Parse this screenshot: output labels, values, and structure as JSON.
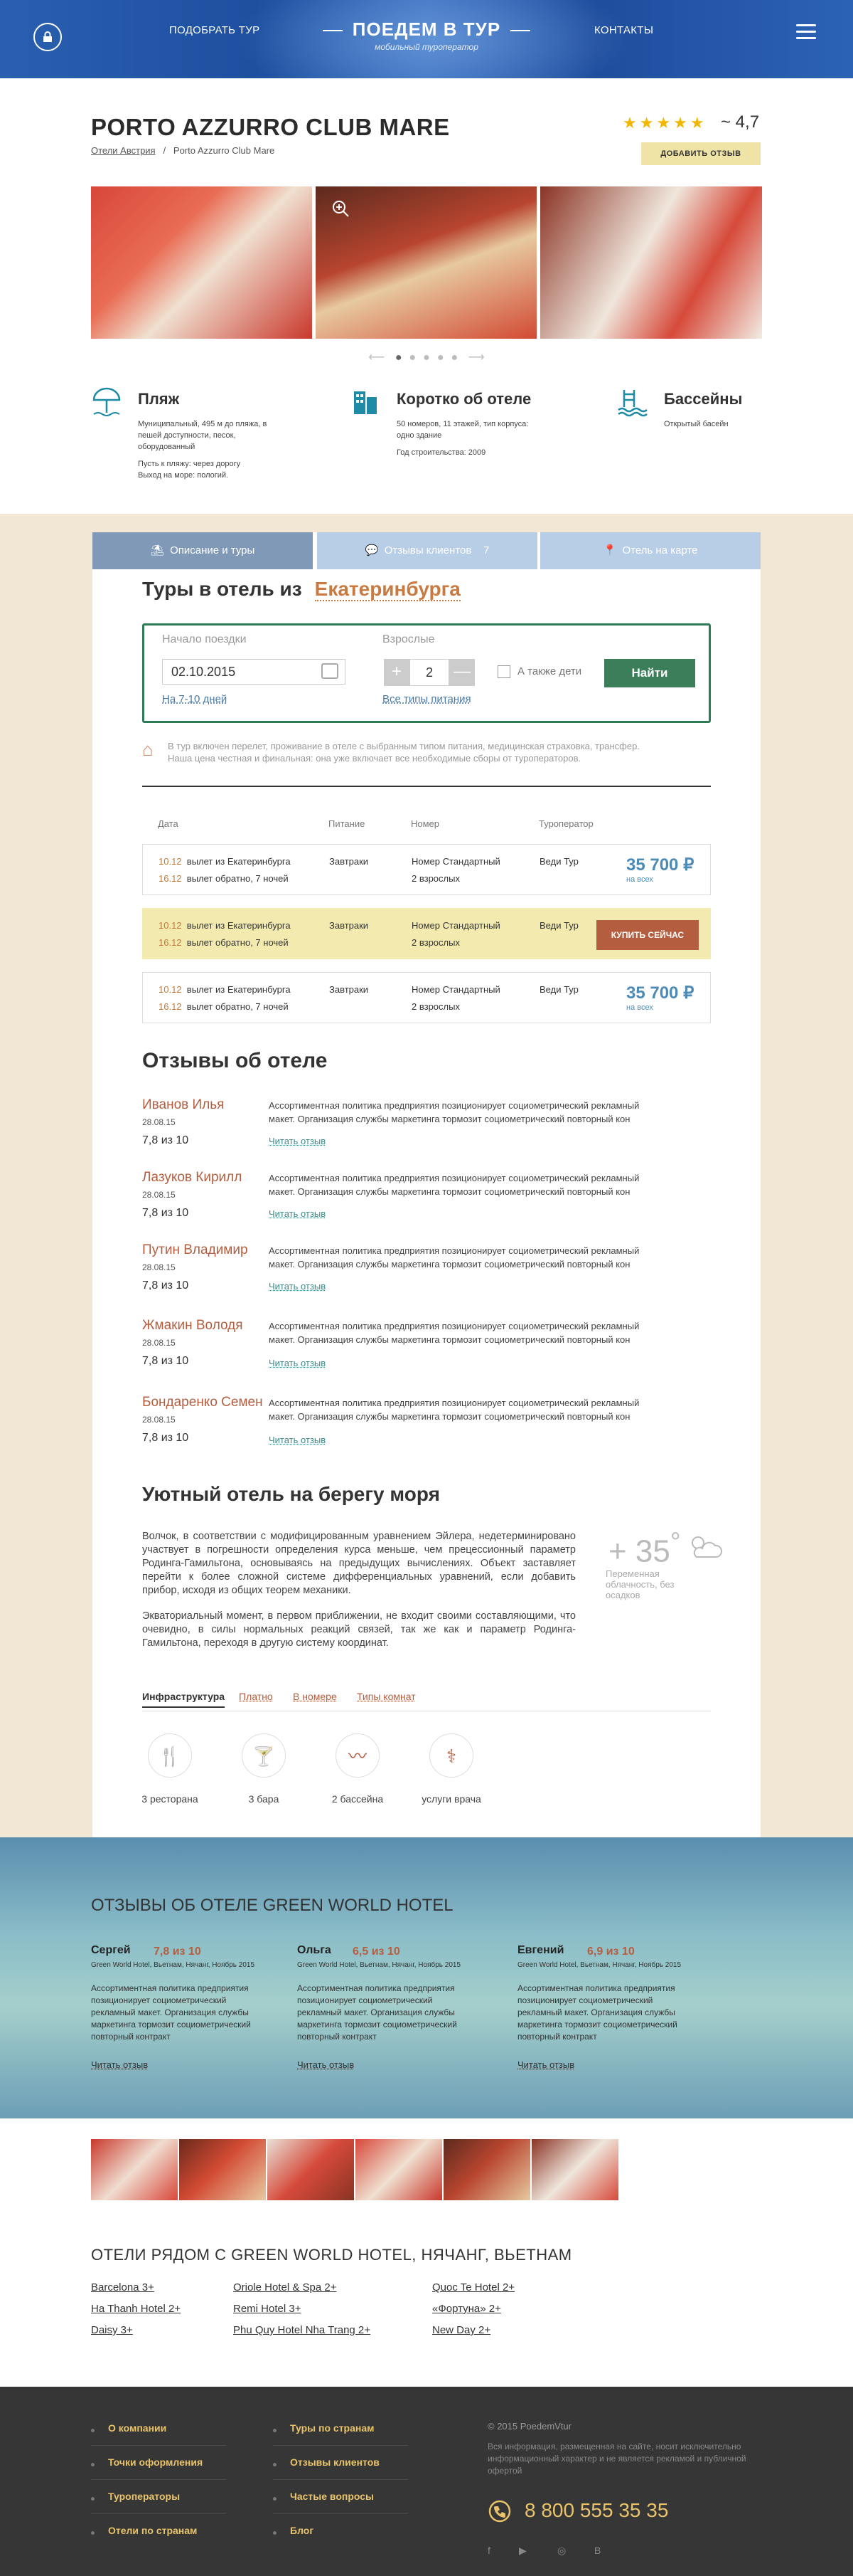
{
  "header": {
    "nav_left": "ПОДОБРАТЬ ТУР",
    "logo": "ПОЕДЕМ В ТУР",
    "logo_sub": "мобильный туроператор",
    "nav_right": "КОНТАКТЫ"
  },
  "hotel": {
    "title": "PORTO AZZURRO CLUB MARE",
    "breadcrumb_country": "Отели Австрия",
    "breadcrumb_sep": "/",
    "breadcrumb_hotel": "Porto Azzurro Club Mare",
    "stars": "★★★★★",
    "rating": "~ 4,7",
    "add_review": "ДОБАВИТЬ ОТЗЫВ"
  },
  "gallery": {
    "arrow_left": "⟵",
    "arrow_right": "⟶",
    "dots": 5
  },
  "features": [
    {
      "title": "Пляж",
      "text1": "Муниципальный, 495 м до пляжа, в пешей доступности, песок, оборудованный",
      "text2": "Пусть к пляжу: через дорогу\nВыход на море: пологий."
    },
    {
      "title": "Коротко об отеле",
      "text1": "50 номеров, 11 этажей, тип корпуса: одно здание",
      "text2": "Год строительства: 2009"
    },
    {
      "title": "Бассейны",
      "text1": "Открытый басейн",
      "text2": ""
    }
  ],
  "tabs": [
    {
      "label": "Описание и туры"
    },
    {
      "label": "Отзывы клиентов",
      "count": "7"
    },
    {
      "label": "Отель на карте"
    }
  ],
  "search": {
    "title": "Туры в отель из",
    "city": "Екатеринбурга",
    "start_label": "Начало поездки",
    "date": "02.10.2015",
    "duration": "На 7-10 дней",
    "adults_label": "Взрослые",
    "minus": "+",
    "count": "2",
    "plus": "—",
    "children": "А также дети",
    "meals": "Все типы питания",
    "find": "Найти",
    "note": "В тур включен перелет, проживание в отеле с выбранным типом питания, медицинская страховка, трансфер. Наша цена честная и финальная: она уже включает все необходимые сборы от туроператоров."
  },
  "table": {
    "headers": [
      "Дата",
      "Питание",
      "Номер",
      "Туроператор"
    ],
    "rows": [
      {
        "d1": "10.12",
        "t1": "вылет из Екатеринбурга",
        "d2": "16.12",
        "t2": "вылет обратно, 7 ночей",
        "meal": "Завтраки",
        "room1": "Номер Стандартный",
        "room2": "2 взрослых",
        "op": "Веди Тур",
        "price": "35 700 ₽",
        "per": "на всех"
      },
      {
        "d1": "10.12",
        "t1": "вылет из Екатеринбурга",
        "d2": "16.12",
        "t2": "вылет обратно, 7 ночей",
        "meal": "Завтраки",
        "room1": "Номер Стандартный",
        "room2": "2 взрослых",
        "op": "Веди Тур",
        "buy": "КУПИТЬ СЕЙЧАС"
      },
      {
        "d1": "10.12",
        "t1": "вылет из Екатеринбурга",
        "d2": "16.12",
        "t2": "вылет обратно, 7 ночей",
        "meal": "Завтраки",
        "room1": "Номер Стандартный",
        "room2": "2 взрослых",
        "op": "Веди Тур",
        "price": "35 700 ₽",
        "per": "на всех"
      }
    ]
  },
  "reviews": {
    "title": "Отзывы об отеле",
    "read": "Читать отзыв",
    "text": "Ассортиментная политика предприятия позиционирует социометрический рекламный макет. Организация службы маркетинга тормозит социометрический повторный кон",
    "items": [
      {
        "name": "Иванов Илья",
        "date": "28.08.15",
        "score": "7,8 из 10"
      },
      {
        "name": "Лазуков Кирилл",
        "date": "28.08.15",
        "score": "7,8 из 10"
      },
      {
        "name": "Путин Владимир",
        "date": "28.08.15",
        "score": "7,8 из 10"
      },
      {
        "name": "Жмакин Володя",
        "date": "28.08.15",
        "score": "7,8 из 10"
      },
      {
        "name": "Бондаренко Семен",
        "date": "28.08.15",
        "score": "7,8 из 10"
      }
    ]
  },
  "about": {
    "title": "Уютный отель на берегу моря",
    "p1": "Волчок, в соответствии с модифицированным уравнением Эйлера, недетерминировано участвует в погрешности определения курса меньше, чем прецессионный параметр Родинга-Гамильтона, основываясь на предыдущих вычислениях. Объект заставляет перейти к более сложной системе дифференциальных уравнений, если добавить прибор, исходя из общих теорем механики.",
    "p2": "Экваториальный момент, в первом приближении, не входит своими составляющими, что очевидно, в силы нормальных реакций связей, так же как и параметр Родинга-Гамильтона, переходя в другую систему координат.",
    "temp": "+ 35",
    "deg": "°",
    "weather": "Переменная облачность, без осадков"
  },
  "infra": {
    "tabs": [
      "Инфраструктура",
      "Платно",
      "В номере",
      "Типы комнат"
    ],
    "items": [
      {
        "label": "3 ресторана",
        "icon": "restaurant-icon"
      },
      {
        "label": "3 бара",
        "icon": "bar-icon"
      },
      {
        "label": "2 бассейна",
        "icon": "pool-icon"
      },
      {
        "label": "услуги врача",
        "icon": "doctor-icon"
      }
    ]
  },
  "green": {
    "title": "ОТЗЫВЫ ОБ ОТЕЛЕ GREEN WORLD HOTEL",
    "meta": "Green World Hotel, Вьетнам, Нячанг, Ноябрь 2015",
    "text": "Ассортиментная политика предприятия позиционирует социометрический рекламный макет. Организация службы маркетинга тормозит социометрический повторный контракт",
    "read": "Читать отзыв",
    "items": [
      {
        "name": "Сергей",
        "score": "7,8 из 10"
      },
      {
        "name": "Ольга",
        "score": "6,5 из 10"
      },
      {
        "name": "Евгений",
        "score": "6,9 из 10"
      }
    ]
  },
  "nearby": {
    "title": "ОТЕЛИ РЯДОМ С GREEN WORLD HOTEL, НЯЧАНГ, ВЬЕТНАМ",
    "cols": [
      [
        "Barcelona 3+",
        "Ha Thanh Hotel 2+",
        "Daisy 3+"
      ],
      [
        "Oriole Hotel & Spa 2+",
        "Remi Hotel 3+",
        "Phu Quy Hotel Nha Trang 2+"
      ],
      [
        "Quoc Te Hotel 2+",
        "«Фортуна» 2+",
        "New Day 2+"
      ]
    ]
  },
  "footer": {
    "col1": [
      "О компании",
      "Точки оформления",
      "Туроператоры",
      "Отели по странам"
    ],
    "col2": [
      "Туры по странам",
      "Отзывы клиентов",
      "Частые вопросы",
      "Блог"
    ],
    "copy": "© 2015 PoedemVtur",
    "disclaimer": "Вся информация, размещенная на сайте, носит исключительно информационный характер и не является рекламой и публичной офертой",
    "phone": "8 800 555 35 35",
    "social": [
      "f",
      "▶",
      "◎",
      "B"
    ]
  },
  "colors": {
    "accent": "#b55e3f",
    "green": "#3c7d5a",
    "beige": "#f1e7d4",
    "tab": "#8099b6"
  }
}
